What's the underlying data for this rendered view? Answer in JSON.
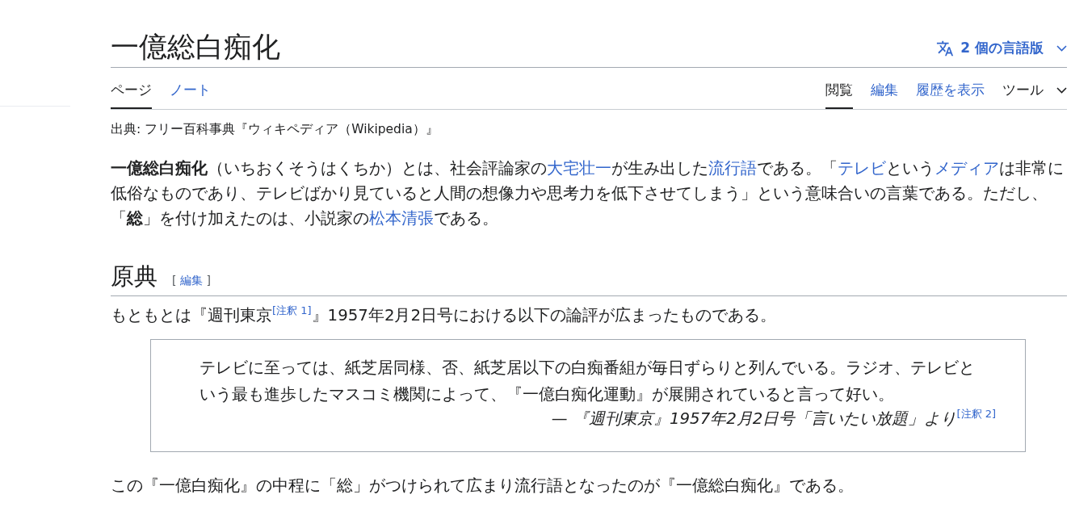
{
  "page_title": "一億総白痴化",
  "language_button": {
    "label": "2 個の言語版"
  },
  "namespace_tabs": [
    {
      "label": "ページ",
      "selected": true
    },
    {
      "label": "ノート",
      "selected": false
    }
  ],
  "view_tabs": [
    {
      "label": "閲覧",
      "selected": true,
      "kind": "link"
    },
    {
      "label": "編集",
      "selected": false,
      "kind": "link"
    },
    {
      "label": "履歴を表示",
      "selected": false,
      "kind": "link"
    },
    {
      "label": "ツール",
      "selected": false,
      "kind": "menu"
    }
  ],
  "source_line": "出典: フリー百科事典『ウィキペディア（Wikipedia）』",
  "intro": [
    {
      "text": "一億総白痴化",
      "kind": "bold"
    },
    {
      "text": "（いちおくそうはくちか）とは、社会評論家の",
      "kind": "plain"
    },
    {
      "text": "大宅壮一",
      "kind": "link"
    },
    {
      "text": "が生み出した",
      "kind": "plain"
    },
    {
      "text": "流行語",
      "kind": "link"
    },
    {
      "text": "である。「",
      "kind": "plain"
    },
    {
      "text": "テレビ",
      "kind": "link"
    },
    {
      "text": "という",
      "kind": "plain"
    },
    {
      "text": "メディア",
      "kind": "link"
    },
    {
      "text": "は非常に低俗なものであり、テレビばかり見ていると人間の想像力や思考力を低下させてしまう」という意味合いの言葉である。ただし、「",
      "kind": "plain"
    },
    {
      "text": "総",
      "kind": "bold"
    },
    {
      "text": "」を付け加えたのは、小説家の",
      "kind": "plain"
    },
    {
      "text": "松本清張",
      "kind": "link"
    },
    {
      "text": "である。",
      "kind": "plain"
    }
  ],
  "sections": [
    {
      "heading": "原典",
      "edit_link": {
        "open": "[",
        "label": "編集",
        "close": "]"
      },
      "blocks": [
        {
          "kind": "paragraph",
          "segments": [
            {
              "text": "もともとは『週刊東京",
              "kind": "plain"
            },
            {
              "text": "[注釈 1]",
              "kind": "ref"
            },
            {
              "text": "』1957年2月2日号における以下の論評が広まったものである。",
              "kind": "plain"
            }
          ]
        },
        {
          "kind": "quote",
          "text": "テレビに至っては、紙芝居同様、否、紙芝居以下の白痴番組が毎日ずらりと列んでいる。ラジオ、テレビという最も進歩したマスコミ機関によって、『一億白痴化運動』が展開されていると言って好い。",
          "attribution": [
            {
              "text": "— ",
              "kind": "plain"
            },
            {
              "text": "『週刊東京』1957年2月2日号「言いたい放題」より",
              "kind": "italic"
            },
            {
              "text": "[注釈 2]",
              "kind": "ref"
            }
          ]
        },
        {
          "kind": "paragraph",
          "segments": [
            {
              "text": "この『一億白痴化』の中程に「総」がつけられて広まり流行語となったのが『一億総白痴化』である。",
              "kind": "plain"
            }
          ]
        }
      ]
    }
  ]
}
